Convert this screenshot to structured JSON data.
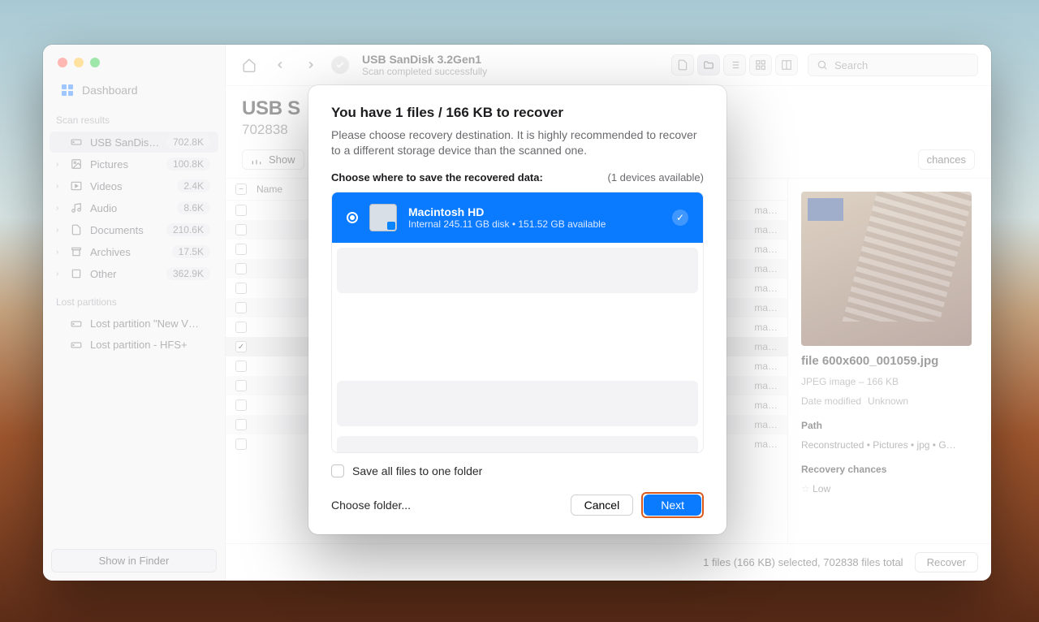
{
  "window": {
    "title": "USB  SanDisk 3.2Gen1",
    "subtitle": "Scan completed successfully",
    "search_placeholder": "Search"
  },
  "sidebar": {
    "dashboard": "Dashboard",
    "scan_results_caption": "Scan results",
    "items": [
      {
        "icon": "drive",
        "label": "USB  SanDisk…",
        "count": "702.8K",
        "selected": true,
        "chev": false
      },
      {
        "icon": "image",
        "label": "Pictures",
        "count": "100.8K",
        "chev": true
      },
      {
        "icon": "video",
        "label": "Videos",
        "count": "2.4K",
        "chev": true
      },
      {
        "icon": "audio",
        "label": "Audio",
        "count": "8.6K",
        "chev": true
      },
      {
        "icon": "doc",
        "label": "Documents",
        "count": "210.6K",
        "chev": true
      },
      {
        "icon": "arch",
        "label": "Archives",
        "count": "17.5K",
        "chev": true
      },
      {
        "icon": "other",
        "label": "Other",
        "count": "362.9K",
        "chev": true
      }
    ],
    "lost_caption": "Lost partitions",
    "lost": [
      {
        "label": "Lost partition \"New V…"
      },
      {
        "label": "Lost partition - HFS+"
      }
    ],
    "show_in_finder": "Show in Finder"
  },
  "page": {
    "header_title": "USB  S",
    "header_subtitle": "702838",
    "filter_show": "Show",
    "filter_chances": "chances",
    "list_header_name": "Name",
    "rows": [
      {
        "checked": false,
        "meta": "ma…"
      },
      {
        "checked": false,
        "meta": "ma…"
      },
      {
        "checked": false,
        "meta": "ma…"
      },
      {
        "checked": false,
        "meta": "ma…"
      },
      {
        "checked": false,
        "meta": "ma…"
      },
      {
        "checked": false,
        "meta": "ma…"
      },
      {
        "checked": false,
        "meta": "ma…"
      },
      {
        "checked": true,
        "meta": "ma…"
      },
      {
        "checked": false,
        "meta": "ma…"
      },
      {
        "checked": false,
        "meta": "ma…"
      },
      {
        "checked": false,
        "meta": "ma…"
      },
      {
        "checked": false,
        "meta": "ma…"
      },
      {
        "checked": false,
        "meta": "ma…"
      }
    ]
  },
  "inspector": {
    "filename": "file 600x600_001059.jpg",
    "type": "JPEG image – 166 KB",
    "date_label": "Date modified",
    "date_value": "Unknown",
    "path_label": "Path",
    "path_value": "Reconstructed • Pictures • jpg • G…",
    "chances_label": "Recovery chances",
    "chances_value": "Low"
  },
  "status": {
    "summary": "1 files (166 KB) selected, 702838 files total",
    "recover": "Recover"
  },
  "modal": {
    "title": "You have 1 files / 166 KB to recover",
    "desc": "Please choose recovery destination. It is highly recommended to recover to a different storage device than the scanned one.",
    "choose_label": "Choose where to save the recovered data:",
    "devices_available": "(1 devices available)",
    "destination": {
      "name": "Macintosh HD",
      "sub": "Internal 245.11 GB disk • 151.52 GB available"
    },
    "save_one": "Save all files to one folder",
    "choose_folder": "Choose folder...",
    "cancel": "Cancel",
    "next": "Next"
  }
}
